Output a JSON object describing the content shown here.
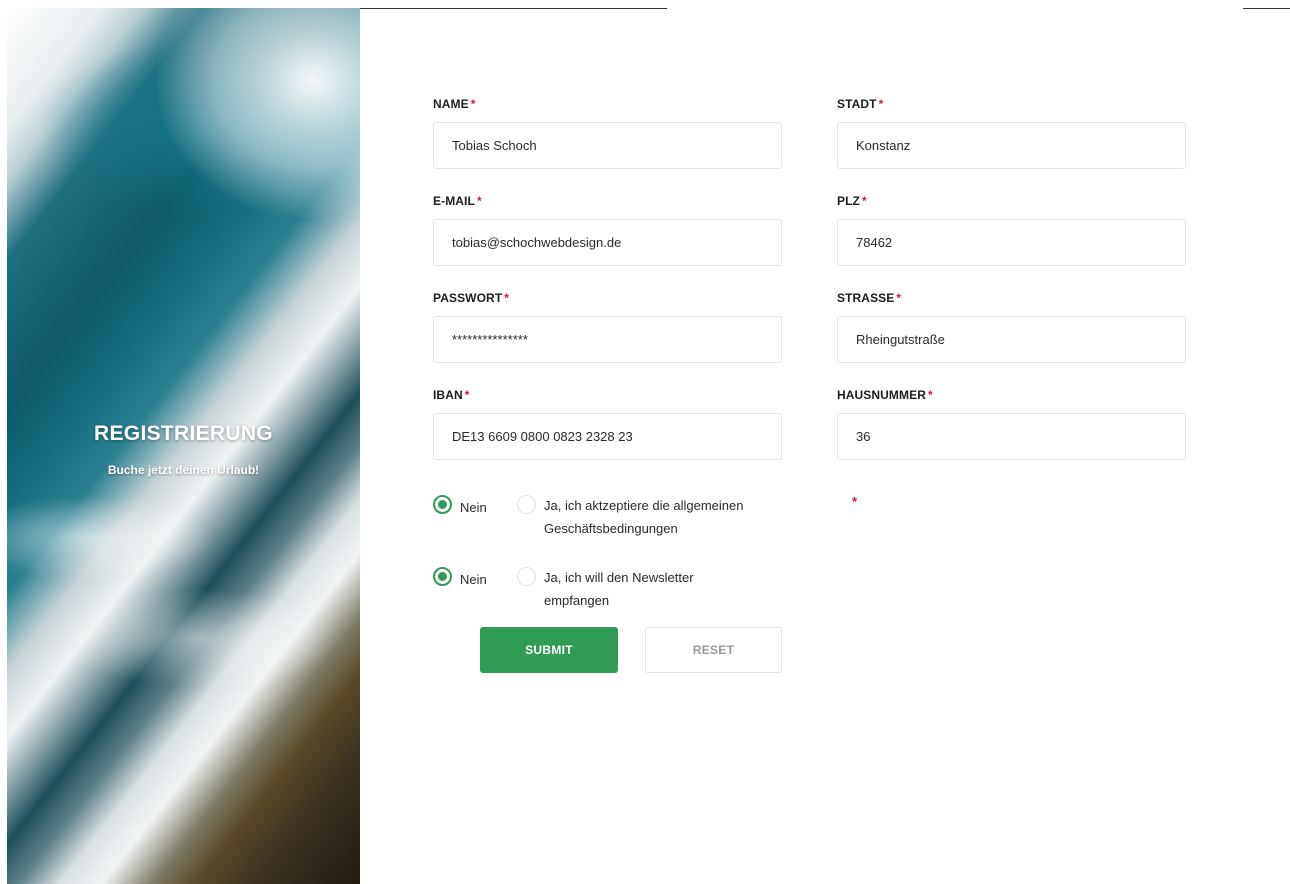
{
  "hero": {
    "title": "REGISTRIERUNG",
    "subtitle": "Buche jetzt deinen Urlaub!"
  },
  "form": {
    "required_marker": "*",
    "name": {
      "label": "NAME",
      "value": "Tobias Schoch"
    },
    "email": {
      "label": "E-MAIL",
      "value": "tobias@schochwebdesign.de"
    },
    "password": {
      "label": "PASSWORT",
      "value": "***************"
    },
    "iban": {
      "label": "IBAN",
      "value": "DE13 6609 0800 0823 2328 23"
    },
    "city": {
      "label": "STADT",
      "value": "Konstanz"
    },
    "zip": {
      "label": "PLZ",
      "value": "78462"
    },
    "street": {
      "label": "STRASSE",
      "value": "Rheingutstraße"
    },
    "house_number": {
      "label": "HAUSNUMMER",
      "value": "36"
    },
    "terms": {
      "no_label": "Nein",
      "yes_label": "Ja, ich aktzeptiere die allgemeinen Geschäftsbedingungen",
      "selected": "no"
    },
    "newsletter": {
      "no_label": "Nein",
      "yes_label": "Ja, ich will den Newsletter empfangen",
      "selected": "no"
    },
    "submit_label": "SUBMIT",
    "reset_label": "RESET"
  },
  "colors": {
    "accent": "#2f9b57",
    "required": "#d0202a"
  }
}
